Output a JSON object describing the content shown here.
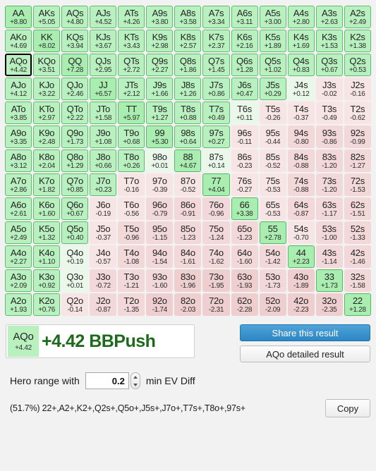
{
  "grid": {
    "rows": [
      [
        {
          "hand": "AA",
          "ev": "+8.80",
          "cat": "push2"
        },
        {
          "hand": "AKs",
          "ev": "+5.05",
          "cat": "push3"
        },
        {
          "hand": "AQs",
          "ev": "+4.80",
          "cat": "push3"
        },
        {
          "hand": "AJs",
          "ev": "+4.52",
          "cat": "push3"
        },
        {
          "hand": "ATs",
          "ev": "+4.26",
          "cat": "push3"
        },
        {
          "hand": "A9s",
          "ev": "+3.80",
          "cat": "push3"
        },
        {
          "hand": "A8s",
          "ev": "+3.58",
          "cat": "push3"
        },
        {
          "hand": "A7s",
          "ev": "+3.34",
          "cat": "push3"
        },
        {
          "hand": "A6s",
          "ev": "+3.11",
          "cat": "push3"
        },
        {
          "hand": "A5s",
          "ev": "+3.00",
          "cat": "push3"
        },
        {
          "hand": "A4s",
          "ev": "+2.80",
          "cat": "push3"
        },
        {
          "hand": "A3s",
          "ev": "+2.63",
          "cat": "push3"
        },
        {
          "hand": "A2s",
          "ev": "+2.49",
          "cat": "push3"
        }
      ],
      [
        {
          "hand": "AKo",
          "ev": "+4.69",
          "cat": "push3"
        },
        {
          "hand": "KK",
          "ev": "+8.02",
          "cat": "push2"
        },
        {
          "hand": "KQs",
          "ev": "+3.94",
          "cat": "push3"
        },
        {
          "hand": "KJs",
          "ev": "+3.67",
          "cat": "push3"
        },
        {
          "hand": "KTs",
          "ev": "+3.43",
          "cat": "push3"
        },
        {
          "hand": "K9s",
          "ev": "+2.98",
          "cat": "push3"
        },
        {
          "hand": "K8s",
          "ev": "+2.57",
          "cat": "push3"
        },
        {
          "hand": "K7s",
          "ev": "+2.37",
          "cat": "push3"
        },
        {
          "hand": "K6s",
          "ev": "+2.16",
          "cat": "push3"
        },
        {
          "hand": "K5s",
          "ev": "+1.89",
          "cat": "push3"
        },
        {
          "hand": "K4s",
          "ev": "+1.69",
          "cat": "push3"
        },
        {
          "hand": "K3s",
          "ev": "+1.53",
          "cat": "push3"
        },
        {
          "hand": "K2s",
          "ev": "+1.38",
          "cat": "push3"
        }
      ],
      [
        {
          "hand": "AQo",
          "ev": "+4.42",
          "cat": "push3",
          "selected": true
        },
        {
          "hand": "KQo",
          "ev": "+3.51",
          "cat": "push3"
        },
        {
          "hand": "QQ",
          "ev": "+7.28",
          "cat": "push2"
        },
        {
          "hand": "QJs",
          "ev": "+2.95",
          "cat": "push3"
        },
        {
          "hand": "QTs",
          "ev": "+2.72",
          "cat": "push3"
        },
        {
          "hand": "Q9s",
          "ev": "+2.27",
          "cat": "push3"
        },
        {
          "hand": "Q8s",
          "ev": "+1.86",
          "cat": "push3"
        },
        {
          "hand": "Q7s",
          "ev": "+1.45",
          "cat": "push3"
        },
        {
          "hand": "Q6s",
          "ev": "+1.28",
          "cat": "push3"
        },
        {
          "hand": "Q5s",
          "ev": "+1.02",
          "cat": "push3"
        },
        {
          "hand": "Q4s",
          "ev": "+0.83",
          "cat": "push3"
        },
        {
          "hand": "Q3s",
          "ev": "+0.67",
          "cat": "push3"
        },
        {
          "hand": "Q2s",
          "ev": "+0.53",
          "cat": "push3"
        }
      ],
      [
        {
          "hand": "AJo",
          "ev": "+4.12",
          "cat": "push3"
        },
        {
          "hand": "KJo",
          "ev": "+3.22",
          "cat": "push3"
        },
        {
          "hand": "QJo",
          "ev": "+2.46",
          "cat": "push3"
        },
        {
          "hand": "JJ",
          "ev": "+6.57",
          "cat": "push2"
        },
        {
          "hand": "JTs",
          "ev": "+2.12",
          "cat": "push3"
        },
        {
          "hand": "J9s",
          "ev": "+1.66",
          "cat": "push3"
        },
        {
          "hand": "J8s",
          "ev": "+1.26",
          "cat": "push3"
        },
        {
          "hand": "J7s",
          "ev": "+0.86",
          "cat": "push3"
        },
        {
          "hand": "J6s",
          "ev": "+0.47",
          "cat": "push3"
        },
        {
          "hand": "J5s",
          "ev": "+0.29",
          "cat": "push3"
        },
        {
          "hand": "J4s",
          "ev": "+0.12",
          "cat": "edge"
        },
        {
          "hand": "J3s",
          "ev": "-0.02",
          "cat": "fold1"
        },
        {
          "hand": "J2s",
          "ev": "-0.16",
          "cat": "fold1"
        }
      ],
      [
        {
          "hand": "ATo",
          "ev": "+3.85",
          "cat": "push3"
        },
        {
          "hand": "KTo",
          "ev": "+2.97",
          "cat": "push3"
        },
        {
          "hand": "QTo",
          "ev": "+2.22",
          "cat": "push3"
        },
        {
          "hand": "JTo",
          "ev": "+1.58",
          "cat": "push3"
        },
        {
          "hand": "TT",
          "ev": "+5.97",
          "cat": "push2"
        },
        {
          "hand": "T9s",
          "ev": "+1.27",
          "cat": "push3"
        },
        {
          "hand": "T8s",
          "ev": "+0.88",
          "cat": "push3"
        },
        {
          "hand": "T7s",
          "ev": "+0.49",
          "cat": "push3"
        },
        {
          "hand": "T6s",
          "ev": "+0.11",
          "cat": "edge"
        },
        {
          "hand": "T5s",
          "ev": "-0.26",
          "cat": "fold1"
        },
        {
          "hand": "T4s",
          "ev": "-0.37",
          "cat": "fold1"
        },
        {
          "hand": "T3s",
          "ev": "-0.49",
          "cat": "fold1"
        },
        {
          "hand": "T2s",
          "ev": "-0.62",
          "cat": "fold1"
        }
      ],
      [
        {
          "hand": "A9o",
          "ev": "+3.35",
          "cat": "push3"
        },
        {
          "hand": "K9o",
          "ev": "+2.48",
          "cat": "push3"
        },
        {
          "hand": "Q9o",
          "ev": "+1.73",
          "cat": "push3"
        },
        {
          "hand": "J9o",
          "ev": "+1.08",
          "cat": "push3"
        },
        {
          "hand": "T9o",
          "ev": "+0.68",
          "cat": "push3"
        },
        {
          "hand": "99",
          "ev": "+5.30",
          "cat": "push2"
        },
        {
          "hand": "98s",
          "ev": "+0.64",
          "cat": "push3"
        },
        {
          "hand": "97s",
          "ev": "+0.27",
          "cat": "push3"
        },
        {
          "hand": "96s",
          "ev": "-0.11",
          "cat": "fold1"
        },
        {
          "hand": "95s",
          "ev": "-0.44",
          "cat": "fold1"
        },
        {
          "hand": "94s",
          "ev": "-0.80",
          "cat": "fold2"
        },
        {
          "hand": "93s",
          "ev": "-0.86",
          "cat": "fold2"
        },
        {
          "hand": "92s",
          "ev": "-0.99",
          "cat": "fold2"
        }
      ],
      [
        {
          "hand": "A8o",
          "ev": "+3.12",
          "cat": "push3"
        },
        {
          "hand": "K8o",
          "ev": "+2.04",
          "cat": "push3"
        },
        {
          "hand": "Q8o",
          "ev": "+1.29",
          "cat": "push3"
        },
        {
          "hand": "J8o",
          "ev": "+0.66",
          "cat": "push3"
        },
        {
          "hand": "T8o",
          "ev": "+0.26",
          "cat": "push3"
        },
        {
          "hand": "98o",
          "ev": "+0.01",
          "cat": "edge"
        },
        {
          "hand": "88",
          "ev": "+4.67",
          "cat": "push2"
        },
        {
          "hand": "87s",
          "ev": "+0.14",
          "cat": "edge"
        },
        {
          "hand": "86s",
          "ev": "-0.23",
          "cat": "fold1"
        },
        {
          "hand": "85s",
          "ev": "-0.52",
          "cat": "fold1"
        },
        {
          "hand": "84s",
          "ev": "-0.88",
          "cat": "fold2"
        },
        {
          "hand": "83s",
          "ev": "-1.20",
          "cat": "fold2"
        },
        {
          "hand": "82s",
          "ev": "-1.27",
          "cat": "fold2"
        }
      ],
      [
        {
          "hand": "A7o",
          "ev": "+2.86",
          "cat": "push3"
        },
        {
          "hand": "K7o",
          "ev": "+1.82",
          "cat": "push3"
        },
        {
          "hand": "Q7o",
          "ev": "+0.85",
          "cat": "push3"
        },
        {
          "hand": "J7o",
          "ev": "+0.23",
          "cat": "push3"
        },
        {
          "hand": "T7o",
          "ev": "-0.16",
          "cat": "fold1"
        },
        {
          "hand": "97o",
          "ev": "-0.39",
          "cat": "fold1"
        },
        {
          "hand": "87o",
          "ev": "-0.52",
          "cat": "fold1"
        },
        {
          "hand": "77",
          "ev": "+4.04",
          "cat": "push2"
        },
        {
          "hand": "76s",
          "ev": "-0.27",
          "cat": "fold1"
        },
        {
          "hand": "75s",
          "ev": "-0.53",
          "cat": "fold1"
        },
        {
          "hand": "74s",
          "ev": "-0.88",
          "cat": "fold2"
        },
        {
          "hand": "73s",
          "ev": "-1.20",
          "cat": "fold2"
        },
        {
          "hand": "72s",
          "ev": "-1.53",
          "cat": "fold2"
        }
      ],
      [
        {
          "hand": "A6o",
          "ev": "+2.61",
          "cat": "push3"
        },
        {
          "hand": "K6o",
          "ev": "+1.60",
          "cat": "push3"
        },
        {
          "hand": "Q6o",
          "ev": "+0.67",
          "cat": "push3"
        },
        {
          "hand": "J6o",
          "ev": "-0.19",
          "cat": "fold1"
        },
        {
          "hand": "T6o",
          "ev": "-0.56",
          "cat": "fold1"
        },
        {
          "hand": "96o",
          "ev": "-0.79",
          "cat": "fold2"
        },
        {
          "hand": "86o",
          "ev": "-0.91",
          "cat": "fold2"
        },
        {
          "hand": "76o",
          "ev": "-0.96",
          "cat": "fold2"
        },
        {
          "hand": "66",
          "ev": "+3.38",
          "cat": "push2"
        },
        {
          "hand": "65s",
          "ev": "-0.53",
          "cat": "fold1"
        },
        {
          "hand": "64s",
          "ev": "-0.87",
          "cat": "fold2"
        },
        {
          "hand": "63s",
          "ev": "-1.17",
          "cat": "fold2"
        },
        {
          "hand": "62s",
          "ev": "-1.51",
          "cat": "fold2"
        }
      ],
      [
        {
          "hand": "A5o",
          "ev": "+2.49",
          "cat": "push3"
        },
        {
          "hand": "K5o",
          "ev": "+1.32",
          "cat": "push3"
        },
        {
          "hand": "Q5o",
          "ev": "+0.40",
          "cat": "push3"
        },
        {
          "hand": "J5o",
          "ev": "-0.37",
          "cat": "fold1"
        },
        {
          "hand": "T5o",
          "ev": "-0.96",
          "cat": "fold2"
        },
        {
          "hand": "95o",
          "ev": "-1.15",
          "cat": "fold2"
        },
        {
          "hand": "85o",
          "ev": "-1.23",
          "cat": "fold2"
        },
        {
          "hand": "75o",
          "ev": "-1.24",
          "cat": "fold2"
        },
        {
          "hand": "65o",
          "ev": "-1.23",
          "cat": "fold2"
        },
        {
          "hand": "55",
          "ev": "+2.78",
          "cat": "push2"
        },
        {
          "hand": "54s",
          "ev": "-0.70",
          "cat": "fold1"
        },
        {
          "hand": "53s",
          "ev": "-1.00",
          "cat": "fold2"
        },
        {
          "hand": "52s",
          "ev": "-1.33",
          "cat": "fold2"
        }
      ],
      [
        {
          "hand": "A4o",
          "ev": "+2.27",
          "cat": "push3"
        },
        {
          "hand": "K4o",
          "ev": "+1.10",
          "cat": "push3"
        },
        {
          "hand": "Q4o",
          "ev": "+0.19",
          "cat": "edge"
        },
        {
          "hand": "J4o",
          "ev": "-0.57",
          "cat": "fold1"
        },
        {
          "hand": "T4o",
          "ev": "-1.08",
          "cat": "fold2"
        },
        {
          "hand": "94o",
          "ev": "-1.54",
          "cat": "fold2"
        },
        {
          "hand": "84o",
          "ev": "-1.61",
          "cat": "fold2"
        },
        {
          "hand": "74o",
          "ev": "-1.62",
          "cat": "fold2"
        },
        {
          "hand": "64o",
          "ev": "-1.60",
          "cat": "fold2"
        },
        {
          "hand": "54o",
          "ev": "-1.42",
          "cat": "fold2"
        },
        {
          "hand": "44",
          "ev": "+2.23",
          "cat": "push2"
        },
        {
          "hand": "43s",
          "ev": "-1.14",
          "cat": "fold2"
        },
        {
          "hand": "42s",
          "ev": "-1.46",
          "cat": "fold2"
        }
      ],
      [
        {
          "hand": "A3o",
          "ev": "+2.09",
          "cat": "push3"
        },
        {
          "hand": "K3o",
          "ev": "+0.92",
          "cat": "push3"
        },
        {
          "hand": "Q3o",
          "ev": "+0.01",
          "cat": "edge"
        },
        {
          "hand": "J3o",
          "ev": "-0.72",
          "cat": "fold2"
        },
        {
          "hand": "T3o",
          "ev": "-1.21",
          "cat": "fold2"
        },
        {
          "hand": "93o",
          "ev": "-1.60",
          "cat": "fold2"
        },
        {
          "hand": "83o",
          "ev": "-1.96",
          "cat": "fold3"
        },
        {
          "hand": "73o",
          "ev": "-1.95",
          "cat": "fold3"
        },
        {
          "hand": "63o",
          "ev": "-1.93",
          "cat": "fold3"
        },
        {
          "hand": "53o",
          "ev": "-1.73",
          "cat": "fold2"
        },
        {
          "hand": "43o",
          "ev": "-1.89",
          "cat": "fold3"
        },
        {
          "hand": "33",
          "ev": "+1.73",
          "cat": "push2"
        },
        {
          "hand": "32s",
          "ev": "-1.58",
          "cat": "fold2"
        }
      ],
      [
        {
          "hand": "A2o",
          "ev": "+1.93",
          "cat": "push3"
        },
        {
          "hand": "K2o",
          "ev": "+0.76",
          "cat": "push3"
        },
        {
          "hand": "Q2o",
          "ev": "-0.14",
          "cat": "fold1"
        },
        {
          "hand": "J2o",
          "ev": "-0.87",
          "cat": "fold2"
        },
        {
          "hand": "T2o",
          "ev": "-1.35",
          "cat": "fold2"
        },
        {
          "hand": "92o",
          "ev": "-1.74",
          "cat": "fold3"
        },
        {
          "hand": "82o",
          "ev": "-2.03",
          "cat": "fold3"
        },
        {
          "hand": "72o",
          "ev": "-2.31",
          "cat": "fold3"
        },
        {
          "hand": "62o",
          "ev": "-2.28",
          "cat": "fold3"
        },
        {
          "hand": "52o",
          "ev": "-2.09",
          "cat": "fold3"
        },
        {
          "hand": "42o",
          "ev": "-2.23",
          "cat": "fold3"
        },
        {
          "hand": "32o",
          "ev": "-2.35",
          "cat": "fold3"
        },
        {
          "hand": "22",
          "ev": "+1.28",
          "cat": "push2"
        }
      ]
    ]
  },
  "result": {
    "hand": "AQo",
    "hand_ev": "+4.42",
    "text": "+4.42 BBPush",
    "share_button": "Share this result",
    "detail_button": "AQo detailed result"
  },
  "hero": {
    "label": "Hero range with",
    "value": "0.2",
    "suffix": "min EV Diff"
  },
  "footer": {
    "range_string": "(51.7%) 22+,A2+,K2+,Q2s+,Q5o+,J5s+,J7o+,T7s+,T8o+,97s+",
    "copy_button": "Copy"
  }
}
